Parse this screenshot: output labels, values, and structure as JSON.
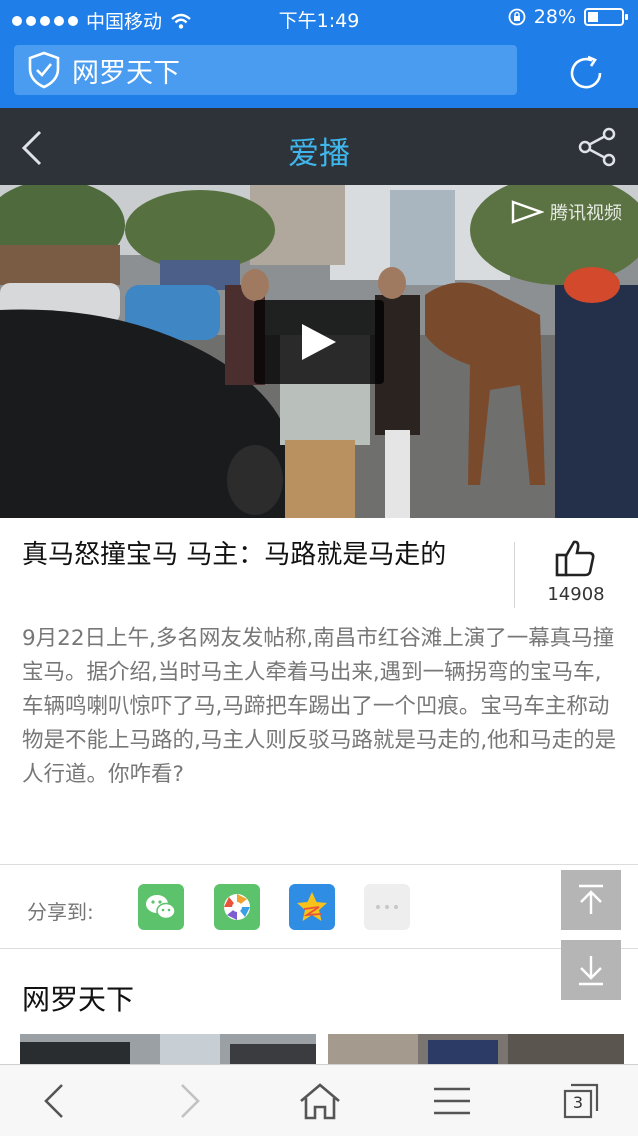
{
  "status_bar": {
    "carrier": "中国移动",
    "time": "下午1:49",
    "battery": "28%"
  },
  "address_bar": {
    "text": "网罗天下"
  },
  "header": {
    "title": "爱播"
  },
  "video": {
    "watermark": "腾讯视频"
  },
  "article": {
    "title": "真马怒撞宝马 马主：马路就是马走的",
    "likes": "14908",
    "body": "9月22日上午,多名网友发帖称,南昌市红谷滩上演了一幕真马撞宝马。据介绍,当时马主人牵着马出来,遇到一辆拐弯的宝马车,车辆鸣喇叭惊吓了马,马蹄把车踢出了一个凹痕。宝马车主称动物是不能上马路的,马主人则反驳马路就是马走的,他和马走的是人行道。你咋看?"
  },
  "share": {
    "label": "分享到:"
  },
  "section": {
    "title": "网罗天下"
  },
  "toolbar": {
    "tab_count": "3"
  },
  "colors": {
    "brand_blue": "#1f7ee8",
    "header_dark": "#2e3339",
    "accent_cyan": "#3fb6ec"
  }
}
